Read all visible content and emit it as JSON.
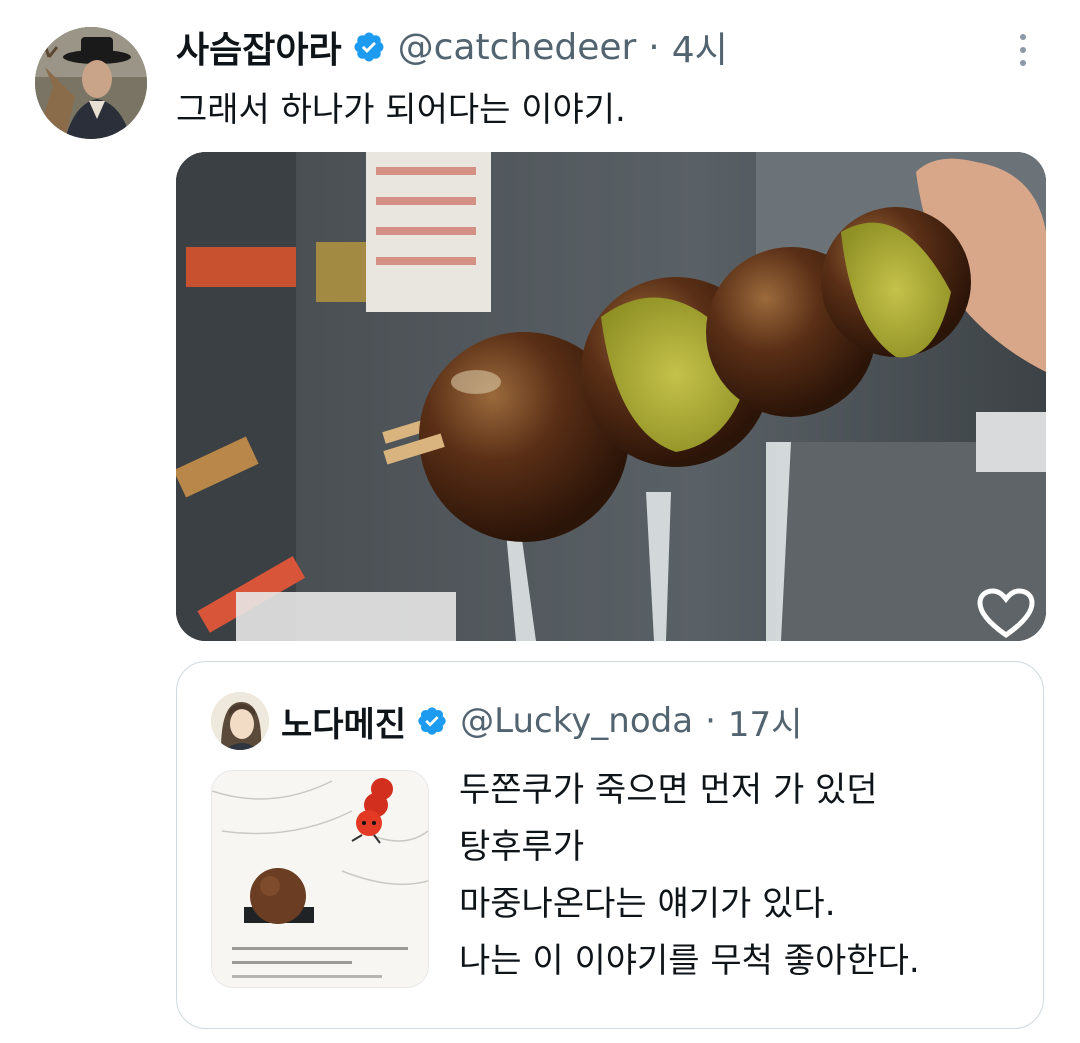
{
  "tweet": {
    "author_name": "사슴잡아라",
    "handle": "@catchedeer",
    "time": "4시",
    "text": "그래서 하나가 되어다는 이야기.",
    "avatar_icon": "profile-photo-hat-deer",
    "more_icon": "more-vertical-icon",
    "media": {
      "description_icon": "photo",
      "like_icon": "heart-outline-icon"
    }
  },
  "quote": {
    "author_name": "노다메진",
    "handle": "@Lucky_noda",
    "time": "17시",
    "lines": [
      "두쫀쿠가 죽으면 먼저 가 있던",
      "탕후루가",
      "마중나온다는 얘기가 있다.",
      "나는 이 이야기를 무척 좋아한다."
    ]
  },
  "colors": {
    "verified": "#1d9bf0",
    "secondary_text": "#536471",
    "border": "#cfd9de"
  }
}
